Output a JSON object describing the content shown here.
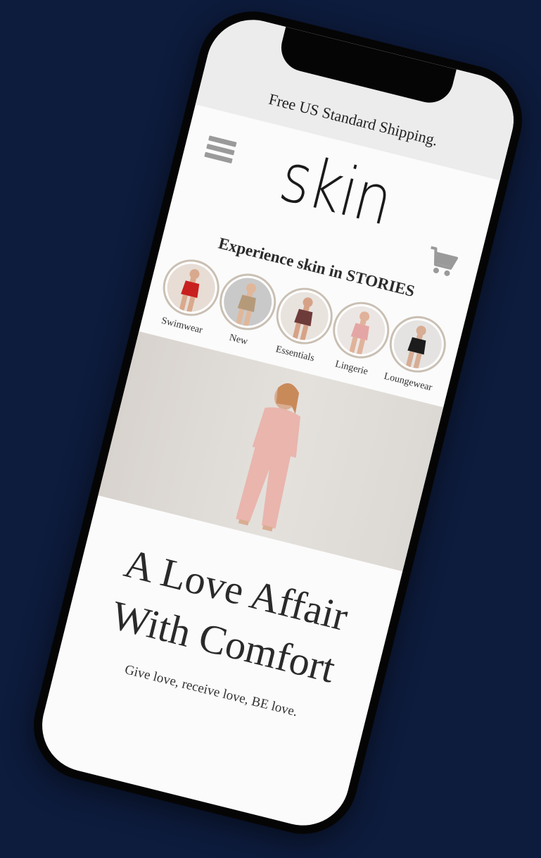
{
  "promo": {
    "text": "Free US Standard Shipping."
  },
  "brand": {
    "logo_text": "skin"
  },
  "stories": {
    "title": "Experience skin in STORIES",
    "items": [
      {
        "label": "Swimwear",
        "bg": "#e7ddd5",
        "garment": "#c8201f",
        "skin": "#d9a98d"
      },
      {
        "label": "New",
        "bg": "#c9c9c9",
        "garment": "#b59a7a",
        "skin": "#e0b79a"
      },
      {
        "label": "Essentials",
        "bg": "#e9e3de",
        "garment": "#6e3b3b",
        "skin": "#d6a287"
      },
      {
        "label": "Lingerie",
        "bg": "#ebe6e3",
        "garment": "#e4a6a5",
        "skin": "#e0b29a"
      },
      {
        "label": "Loungewear",
        "bg": "#e5e3e1",
        "garment": "#1c1c1c",
        "skin": "#d7ad94"
      }
    ]
  },
  "hero": {
    "garment_color": "#e9b5ad"
  },
  "headline": {
    "line1": "A Love Affair",
    "line2": "With Comfort"
  },
  "tagline": {
    "text": "Give love, receive love, BE love."
  },
  "colors": {
    "background": "#0d1b3c",
    "promo_bar": "#ececec",
    "icon_gray": "#9a9a9a"
  }
}
